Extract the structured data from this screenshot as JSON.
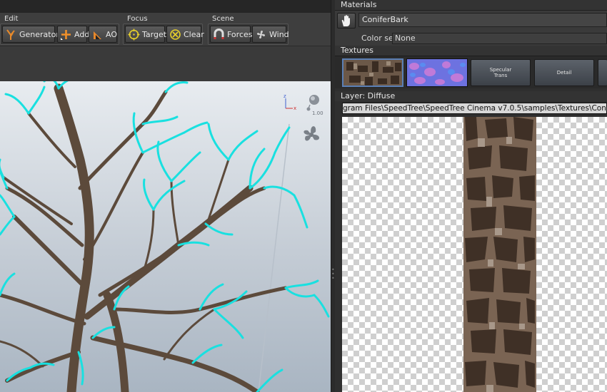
{
  "toolbar": {
    "groups": [
      {
        "title": "Edit",
        "buttons": [
          {
            "label": "Generators",
            "icon": "generators-icon"
          },
          {
            "label": "Add",
            "icon": "add-icon"
          },
          {
            "label": "AO",
            "icon": "ao-icon"
          }
        ]
      },
      {
        "title": "Focus",
        "buttons": [
          {
            "label": "Target",
            "icon": "target-icon"
          },
          {
            "label": "Clear",
            "icon": "clear-icon"
          }
        ]
      },
      {
        "title": "Scene",
        "buttons": [
          {
            "label": "Forces",
            "icon": "forces-icon"
          },
          {
            "label": "Wind",
            "icon": "wind-icon"
          }
        ]
      }
    ]
  },
  "viewport": {
    "axis_labels": {
      "z": "z",
      "x": "x"
    },
    "zoom_readout": "1.00",
    "colors": {
      "branch_highlight": "#19e0e0",
      "bark": "#6b5a4a"
    }
  },
  "materials": {
    "header": "Materials",
    "name": "ConiferBark",
    "color_set_label": "Color set",
    "color_set_value": "None"
  },
  "textures": {
    "header": "Textures",
    "slots": [
      {
        "kind": "thumbnail",
        "name": "diffuse-thumbnail"
      },
      {
        "kind": "thumbnail",
        "name": "normal-thumbnail"
      },
      {
        "kind": "slot",
        "line1": "Specular",
        "line2": "Trans"
      },
      {
        "kind": "slot",
        "line1": "Detail",
        "line2": ""
      }
    ]
  },
  "layer": {
    "header": "Layer: Diffuse",
    "path": "gram Files\\SpeedTree\\SpeedTree Cinema v7.0.5\\samples\\Textures\\ConiferBark"
  }
}
